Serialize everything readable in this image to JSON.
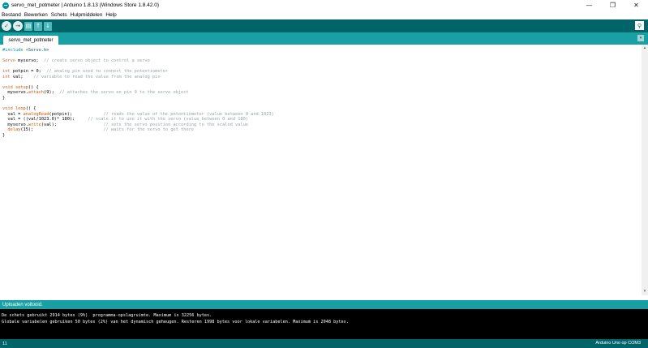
{
  "window": {
    "title": "servo_met_potmeter | Arduino 1.8.13 (Windows Store 1.8.42.0)",
    "minimize_glyph": "—",
    "maximize_glyph": "❐",
    "close_glyph": "✕"
  },
  "menu": {
    "items": [
      "Bestand",
      "Bewerken",
      "Schets",
      "Hulpmiddelen",
      "Help"
    ]
  },
  "toolbar": {
    "buttons": [
      {
        "name": "verify",
        "icon": "check-icon",
        "glyph": "✓"
      },
      {
        "name": "upload",
        "icon": "arrow-right-icon",
        "glyph": "→"
      },
      {
        "name": "new",
        "icon": "new-file-icon",
        "glyph": "▤"
      },
      {
        "name": "open",
        "icon": "arrow-up-icon",
        "glyph": "↑"
      },
      {
        "name": "save",
        "icon": "arrow-down-icon",
        "glyph": "↓"
      }
    ],
    "serial_monitor_glyph": "⚲"
  },
  "tabs": [
    {
      "label": "servo_met_potmeter",
      "active": true
    }
  ],
  "tab_menu_glyph": "▾",
  "editor": {
    "lines": [
      [
        [
          "pp",
          "#include "
        ],
        [
          "st",
          "<Servo.h>"
        ]
      ],
      [],
      [
        [
          "ty",
          "Servo"
        ],
        [
          "",
          " myservo;  "
        ],
        [
          "cm",
          "// create servo object to control a servo"
        ]
      ],
      [],
      [
        [
          "ty",
          "int"
        ],
        [
          "",
          " potpin = 0;  "
        ],
        [
          "cm",
          "// analog pin used to connect the potentiometer"
        ]
      ],
      [
        [
          "ty",
          "int"
        ],
        [
          "",
          " val;    "
        ],
        [
          "cm",
          "// variable to read the value from the analog pin"
        ]
      ],
      [],
      [
        [
          "ty",
          "void"
        ],
        [
          "",
          " "
        ],
        [
          "fn",
          "setup"
        ],
        [
          "",
          "() {"
        ]
      ],
      [
        [
          "",
          "  myservo."
        ],
        [
          "fn",
          "attach"
        ],
        [
          "",
          "(9);  "
        ],
        [
          "cm",
          "// attaches the servo on pin 9 to the servo object"
        ]
      ],
      [
        [
          "",
          "}"
        ]
      ],
      [],
      [
        [
          "ty",
          "void"
        ],
        [
          "",
          " "
        ],
        [
          "fn",
          "loop"
        ],
        [
          "",
          "() {"
        ]
      ],
      [
        [
          "",
          "  val = "
        ],
        [
          "fn",
          "analogRead"
        ],
        [
          "",
          "(potpin);            "
        ],
        [
          "cm",
          "// reads the value of the potentiometer (value between 0 and 1023)"
        ]
      ],
      [
        [
          "",
          "  val = ((val/1023.0)* 180);     "
        ],
        [
          "cm",
          "// scale it to use it with the servo (value between 0 and 180)"
        ]
      ],
      [
        [
          "",
          "  myservo."
        ],
        [
          "fn",
          "write"
        ],
        [
          "",
          "(val);                  "
        ],
        [
          "cm",
          "// sets the servo position according to the scaled value"
        ]
      ],
      [
        [
          "",
          "  "
        ],
        [
          "fn",
          "delay"
        ],
        [
          "",
          "(15);                           "
        ],
        [
          "cm",
          "// waits for the servo to get there"
        ]
      ],
      [
        [
          "",
          "}"
        ]
      ]
    ],
    "scroll_up_glyph": "▴",
    "scroll_down_glyph": "▾"
  },
  "status": {
    "message": "Uploaden voltooid."
  },
  "console": {
    "lines": [
      "De schets gebruikt 2914 bytes (9%)  programma-opslagruimte. Maximum is 32256 bytes.",
      "Globale variabelen gebruiken 50 bytes (2%) van het dynamisch geheugen. Resteren 1998 bytes voor lokale variabelen. Maximum is 2048 bytes."
    ]
  },
  "bottom": {
    "line_number": "11",
    "board": "Arduino Uno op COM3"
  },
  "colors": {
    "toolbar": "#006468",
    "tabbar": "#17a1a5",
    "keyword": "#00979c",
    "type": "#cc6633",
    "function": "#d35400",
    "comment": "#95a5a6"
  }
}
